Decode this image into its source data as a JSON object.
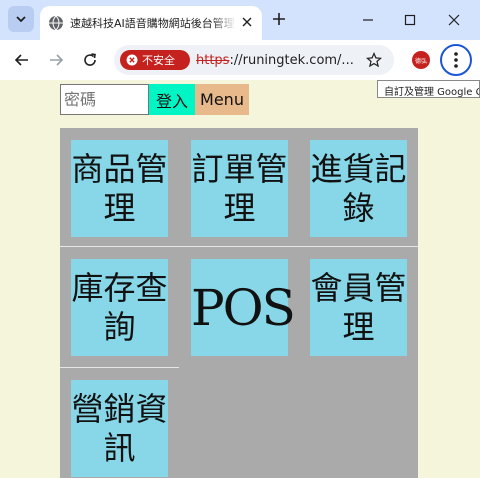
{
  "browser": {
    "tab_title": "速越科技AI語音購物網站後台管理系統",
    "security_label": "不安全",
    "url_scheme": "https",
    "url_rest": "://runingtek.com/...",
    "profile_label": "德弘",
    "tooltip": "自訂及管理 Google Chrome"
  },
  "login": {
    "password_placeholder": "密碼",
    "login_label": "登入",
    "menu_label": "Menu"
  },
  "tiles": [
    {
      "label": "商品管理"
    },
    {
      "label": "訂單管理"
    },
    {
      "label": "進貨記錄"
    },
    {
      "label": "庫存查詢"
    },
    {
      "label": "POS"
    },
    {
      "label": "會員管理"
    },
    {
      "label": "營銷資訊"
    }
  ],
  "colors": {
    "page_bg": "#f5f5dc",
    "tile_bg": "#87d7e8",
    "grid_bg": "#aaaaaa",
    "login_btn": "#00f5c4",
    "menu_btn": "#e8b98a"
  }
}
